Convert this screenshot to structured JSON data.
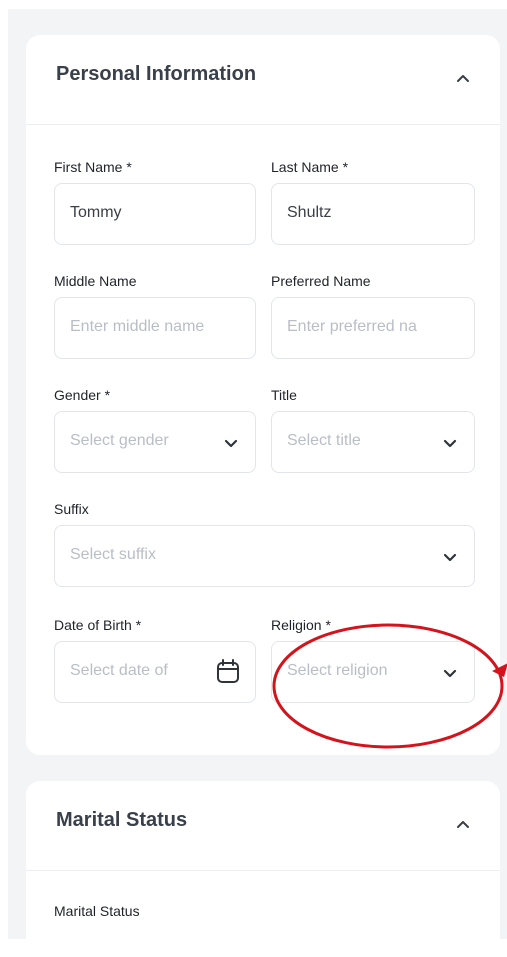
{
  "personal": {
    "title": "Personal Information",
    "first_name": {
      "label": "First Name *",
      "value": "Tommy"
    },
    "last_name": {
      "label": "Last Name *",
      "value": "Shultz"
    },
    "middle_name": {
      "label": "Middle Name",
      "placeholder": "Enter middle name"
    },
    "preferred_name": {
      "label": "Preferred Name",
      "placeholder": "Enter preferred na"
    },
    "gender": {
      "label": "Gender *",
      "placeholder": "Select gender"
    },
    "title_field": {
      "label": "Title",
      "placeholder": "Select title"
    },
    "suffix": {
      "label": "Suffix",
      "placeholder": "Select suffix"
    },
    "dob": {
      "label": "Date of Birth *",
      "placeholder": "Select date of"
    },
    "religion": {
      "label": "Religion *",
      "placeholder": "Select religion"
    }
  },
  "marital": {
    "title": "Marital Status",
    "marital_status": {
      "label": "Marital Status"
    }
  },
  "colors": {
    "annotation": "#d4141c",
    "label": "#1f2329",
    "placeholder": "#b9bec6",
    "border": "#e2e5ea"
  },
  "icons": {
    "collapse": "chevron-up-icon",
    "dropdown": "chevron-down-icon",
    "date": "calendar-icon"
  }
}
